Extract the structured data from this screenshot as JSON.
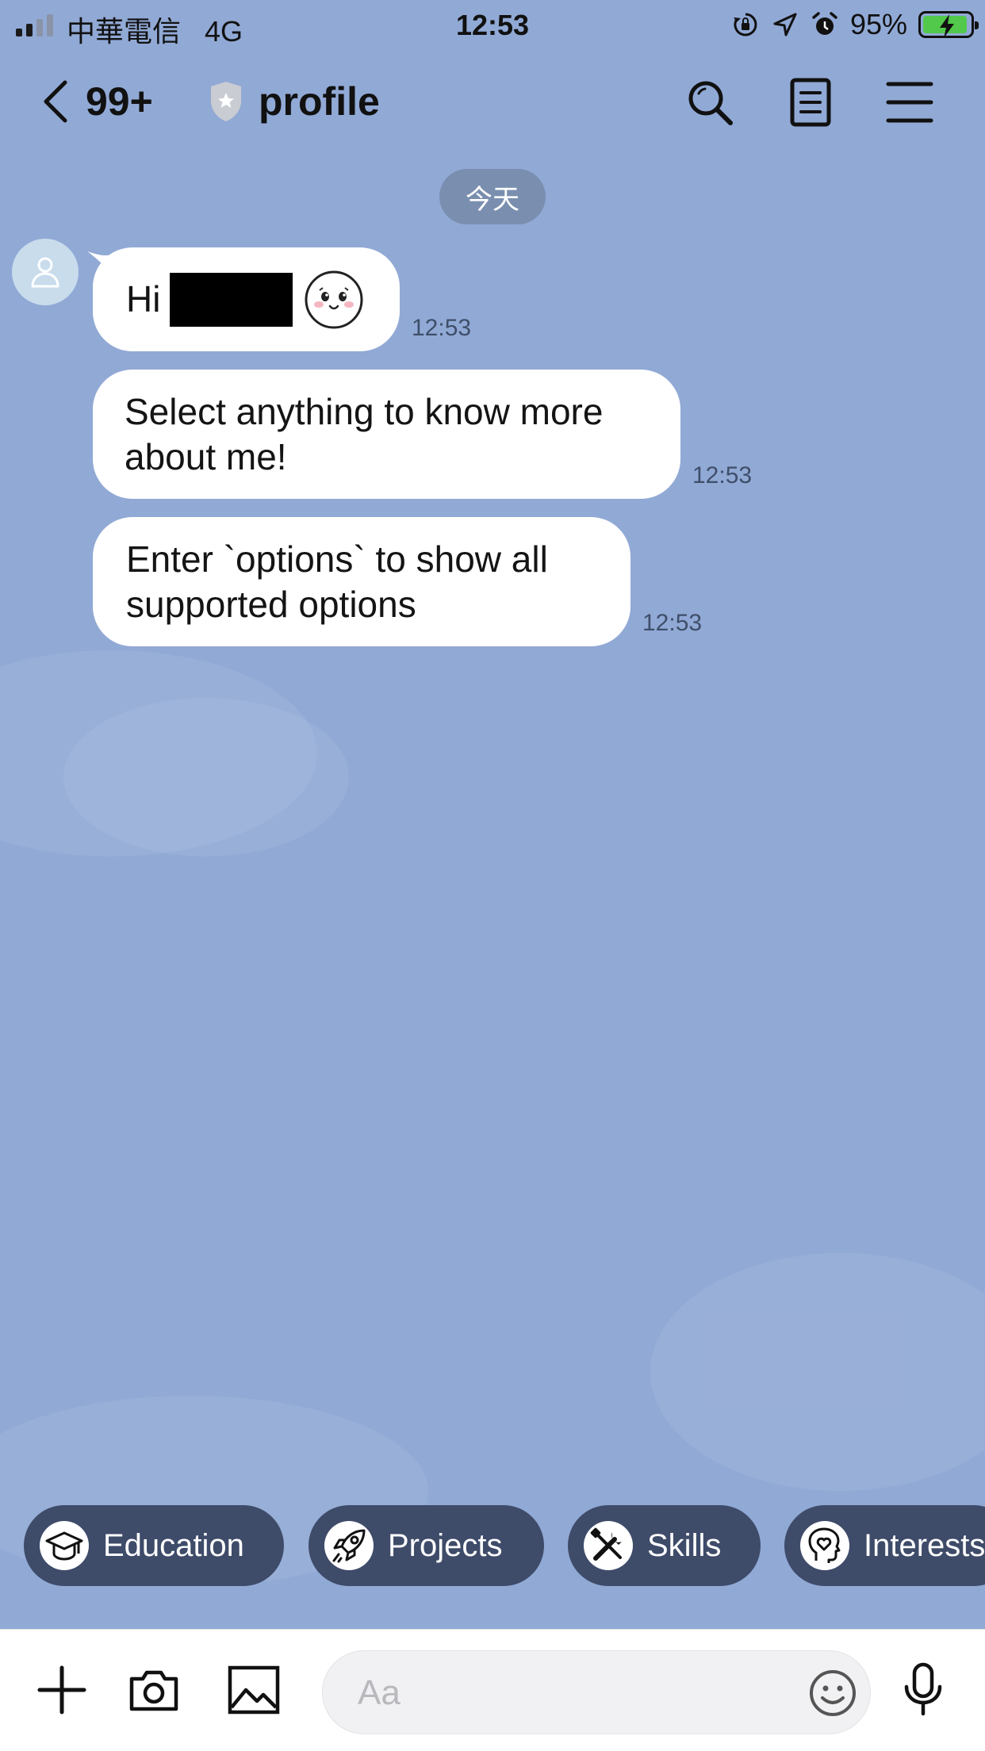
{
  "status_bar": {
    "carrier": "中華電信",
    "network": "4G",
    "time": "12:53",
    "battery_percent": "95%",
    "battery_level": 0.95,
    "battery_color": "#52c94a"
  },
  "header": {
    "unread_count": "99+",
    "title": "profile"
  },
  "date_divider": "今天",
  "messages": [
    {
      "text": "Hi",
      "time": "12:53"
    },
    {
      "text": "Select anything to know more about me!",
      "time": "12:53"
    },
    {
      "text": "Enter `options` to show all supported options",
      "time": "12:53"
    }
  ],
  "quick_replies": [
    {
      "label": "Education",
      "icon": "graduation-cap-icon"
    },
    {
      "label": "Projects",
      "icon": "rocket-icon"
    },
    {
      "label": "Skills",
      "icon": "tools-icon"
    },
    {
      "label": "Interests",
      "icon": "heart-head-icon"
    }
  ],
  "input": {
    "placeholder": "Aa"
  },
  "colors": {
    "background": "#91a9d5",
    "chip": "#3e4b69",
    "date_pill": "#7a8faf"
  }
}
